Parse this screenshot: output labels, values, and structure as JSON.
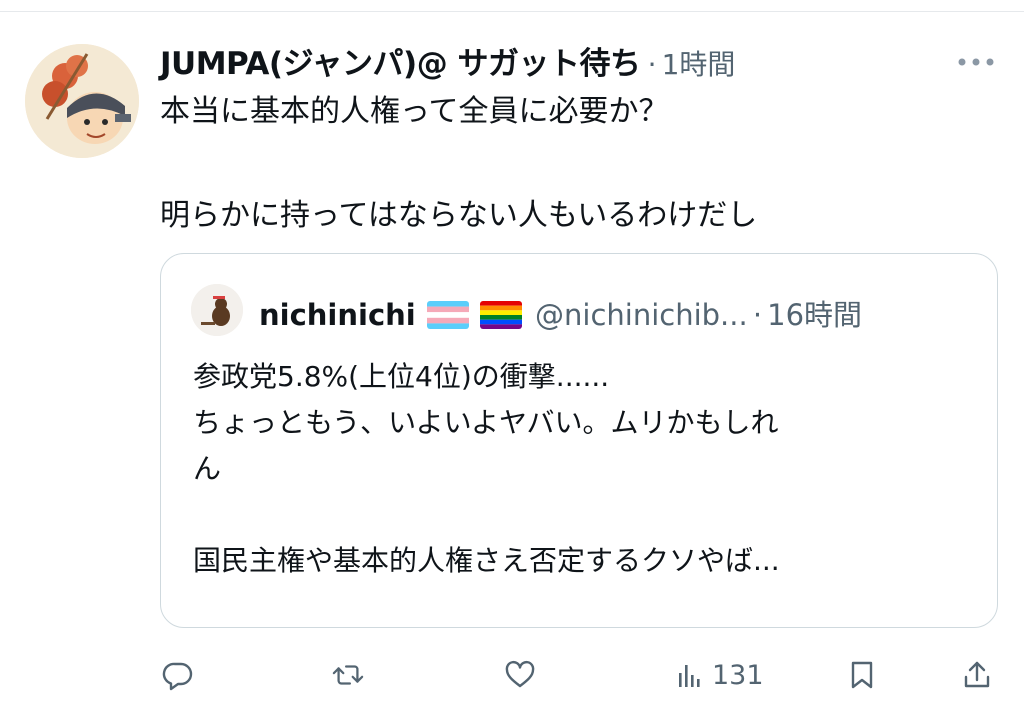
{
  "tweet": {
    "display_name": "JUMPA(ジャンパ)@ サガット待ち",
    "separator": "·",
    "time": "1時間",
    "text_line1": "本当に基本的人権って全員に必要か？",
    "text_line2": "明らかに持ってはならない人もいるわけだし"
  },
  "quote": {
    "display_name": "nichinichi",
    "handle": "@nichinichib...",
    "separator": "·",
    "time": "16時間",
    "lines": [
      "参政党5.8%(上位4位)の衝撃......",
      "ちょっともう、いよいよヤバい。ムリかもしれ",
      "ん",
      "",
      "国民主権や基本的人権さえ否定するクソやば..."
    ]
  },
  "actions": {
    "views": "131"
  },
  "icons": {
    "more": "more-icon",
    "reply": "reply-icon",
    "retweet": "retweet-icon",
    "like": "like-icon",
    "views": "views-icon",
    "bookmark": "bookmark-icon",
    "share": "share-icon",
    "trans_flag": "transgender-flag-icon",
    "rainbow_flag": "rainbow-flag-icon"
  },
  "colors": {
    "text": "#0f1419",
    "muted": "#536471",
    "border": "#cfd9de"
  }
}
